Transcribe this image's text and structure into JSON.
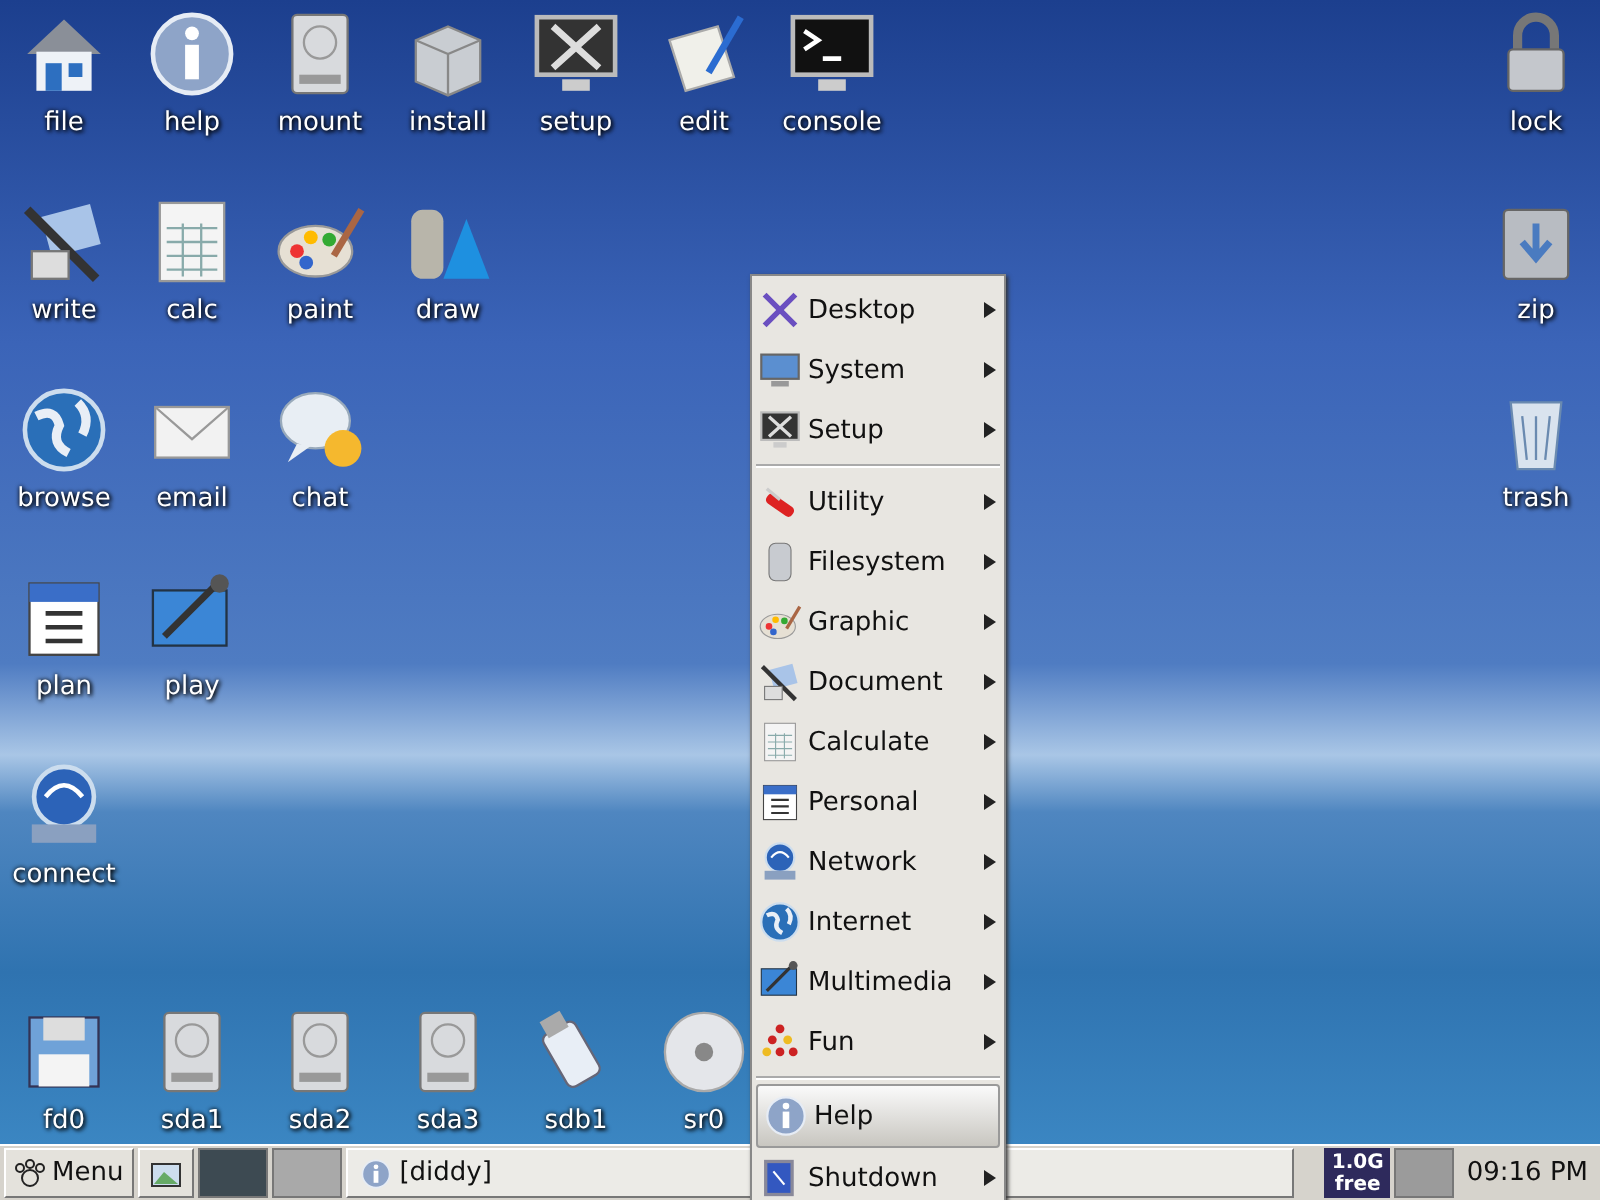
{
  "desktop": {
    "rows": [
      [
        {
          "label": "file",
          "kind": "house"
        },
        {
          "label": "help",
          "kind": "info"
        },
        {
          "label": "mount",
          "kind": "drive"
        },
        {
          "label": "install",
          "kind": "box"
        },
        {
          "label": "setup",
          "kind": "tools"
        },
        {
          "label": "edit",
          "kind": "paper"
        },
        {
          "label": "console",
          "kind": "terminal"
        }
      ],
      [
        {
          "label": "write",
          "kind": "pen"
        },
        {
          "label": "calc",
          "kind": "sheet"
        },
        {
          "label": "paint",
          "kind": "palette"
        },
        {
          "label": "draw",
          "kind": "shapes"
        }
      ],
      [
        {
          "label": "browse",
          "kind": "globe"
        },
        {
          "label": "email",
          "kind": "mail"
        },
        {
          "label": "chat",
          "kind": "chat"
        }
      ],
      [
        {
          "label": "plan",
          "kind": "calendar"
        },
        {
          "label": "play",
          "kind": "media"
        }
      ],
      [
        {
          "label": "connect",
          "kind": "network"
        }
      ]
    ],
    "right_column": [
      {
        "label": "lock",
        "kind": "lock"
      },
      {
        "label": "zip",
        "kind": "zip"
      },
      {
        "label": "trash",
        "kind": "trash"
      }
    ],
    "drives": [
      {
        "label": "fd0",
        "kind": "floppy"
      },
      {
        "label": "sda1",
        "kind": "drive"
      },
      {
        "label": "sda2",
        "kind": "drive"
      },
      {
        "label": "sda3",
        "kind": "drive"
      },
      {
        "label": "sdb1",
        "kind": "usb"
      },
      {
        "label": "sr0",
        "kind": "disc"
      }
    ]
  },
  "menu": {
    "items": [
      {
        "label": "Desktop",
        "kind": "x",
        "submenu": true,
        "selected": false,
        "separator_after": false
      },
      {
        "label": "System",
        "kind": "monitor",
        "submenu": true,
        "selected": false,
        "separator_after": false
      },
      {
        "label": "Setup",
        "kind": "tools",
        "submenu": true,
        "selected": false,
        "separator_after": true
      },
      {
        "label": "Utility",
        "kind": "knife",
        "submenu": true,
        "selected": false,
        "separator_after": false
      },
      {
        "label": "Filesystem",
        "kind": "cylinder",
        "submenu": true,
        "selected": false,
        "separator_after": false
      },
      {
        "label": "Graphic",
        "kind": "palette",
        "submenu": true,
        "selected": false,
        "separator_after": false
      },
      {
        "label": "Document",
        "kind": "pen",
        "submenu": true,
        "selected": false,
        "separator_after": false
      },
      {
        "label": "Calculate",
        "kind": "sheet",
        "submenu": true,
        "selected": false,
        "separator_after": false
      },
      {
        "label": "Personal",
        "kind": "calendar",
        "submenu": true,
        "selected": false,
        "separator_after": false
      },
      {
        "label": "Network",
        "kind": "network",
        "submenu": true,
        "selected": false,
        "separator_after": false
      },
      {
        "label": "Internet",
        "kind": "globe",
        "submenu": true,
        "selected": false,
        "separator_after": false
      },
      {
        "label": "Multimedia",
        "kind": "media",
        "submenu": true,
        "selected": false,
        "separator_after": false
      },
      {
        "label": "Fun",
        "kind": "dots",
        "submenu": true,
        "selected": false,
        "separator_after": true
      },
      {
        "label": "Help",
        "kind": "info",
        "submenu": false,
        "selected": true,
        "separator_after": false
      },
      {
        "label": "Shutdown",
        "kind": "power",
        "submenu": true,
        "selected": false,
        "separator_after": false
      }
    ]
  },
  "taskbar": {
    "menu_button": "Menu",
    "pager": [
      {
        "selected": true
      },
      {
        "selected": false
      }
    ],
    "tasks": [
      {
        "label": "[diddy]"
      }
    ],
    "memory": {
      "line_1": "1.0G",
      "line_2": "free"
    },
    "clock": "09:16 PM"
  }
}
